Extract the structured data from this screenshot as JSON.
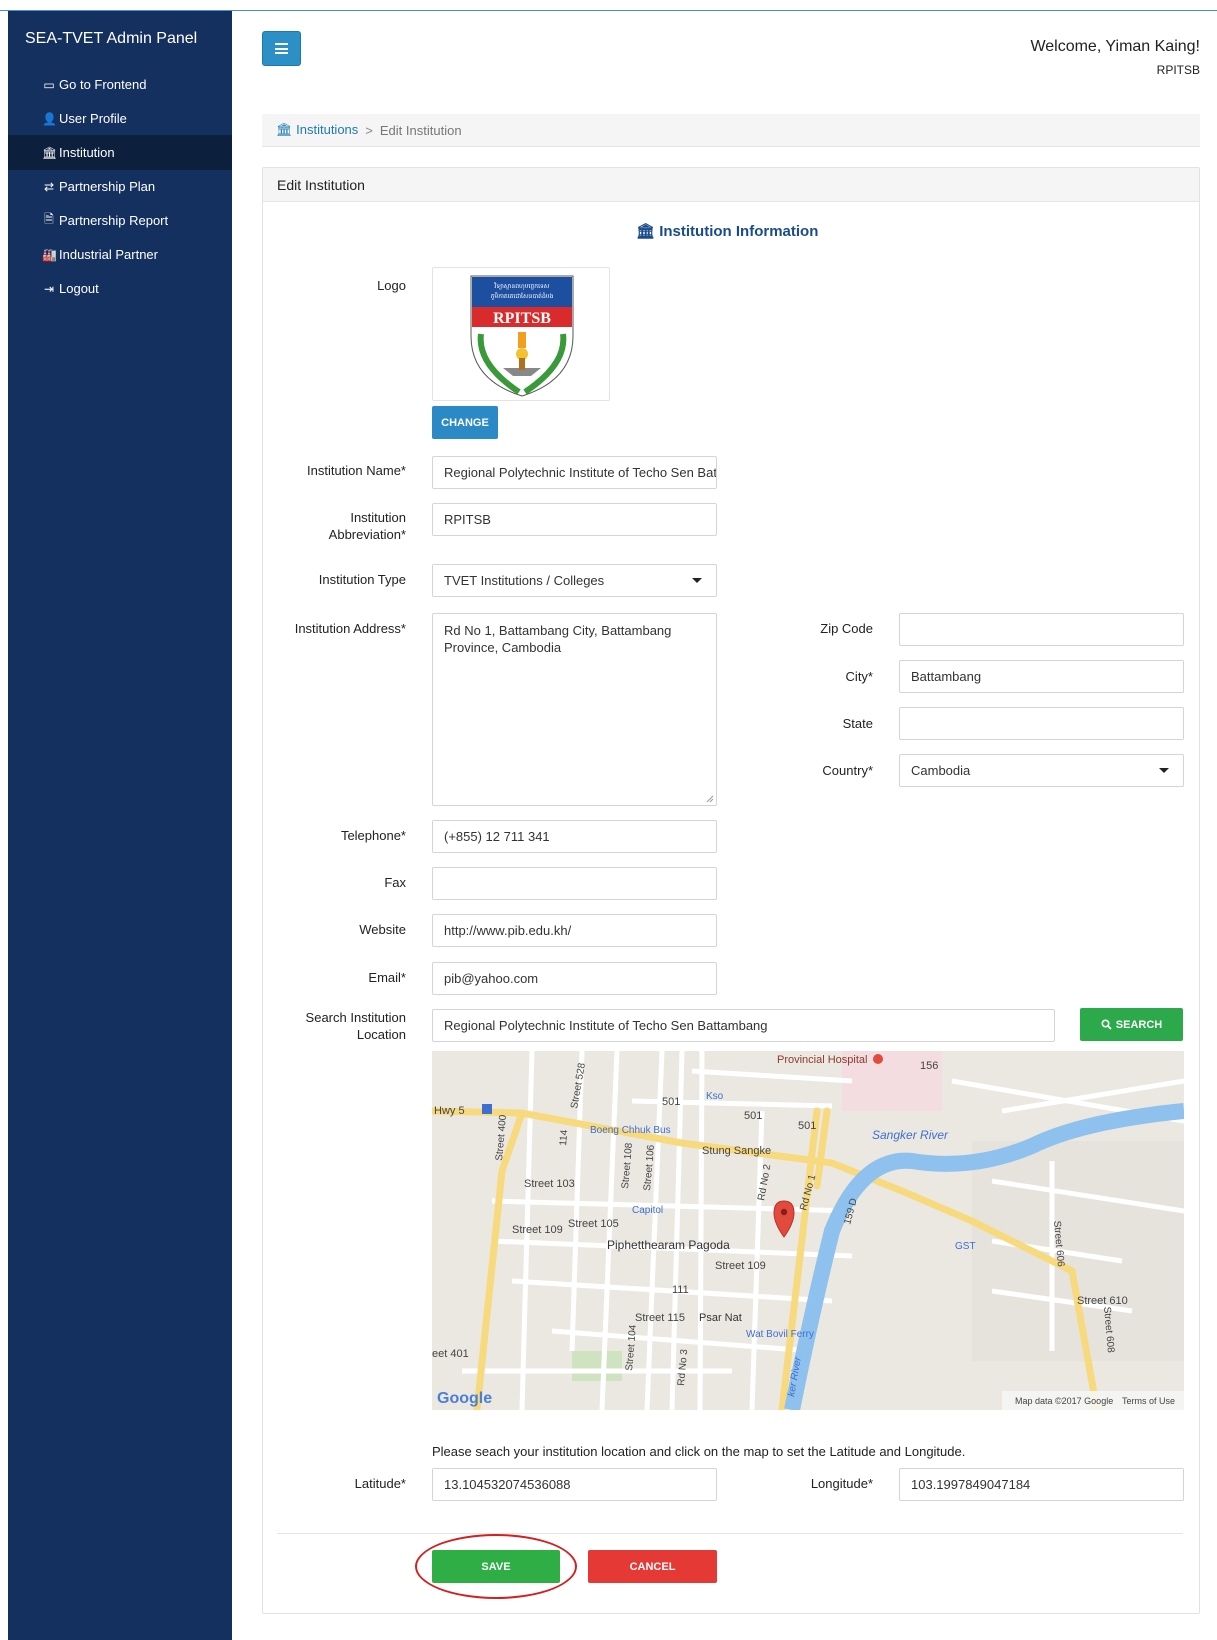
{
  "sidebar": {
    "brand": "SEA-TVET Admin Panel",
    "items": [
      {
        "label": "Go to Frontend",
        "icon": "window-icon",
        "glyph": "▭"
      },
      {
        "label": "User Profile",
        "icon": "user-icon",
        "glyph": "👤"
      },
      {
        "label": "Institution",
        "icon": "institution-icon",
        "glyph": "🏛"
      },
      {
        "label": "Partnership Plan",
        "icon": "exchange-icon",
        "glyph": "⇄"
      },
      {
        "label": "Partnership Report",
        "icon": "report-icon",
        "glyph": "🗎"
      },
      {
        "label": "Industrial Partner",
        "icon": "industry-icon",
        "glyph": "🏭"
      },
      {
        "label": "Logout",
        "icon": "logout-icon",
        "glyph": "⇥"
      }
    ],
    "active_index": 2
  },
  "header": {
    "welcome": "Welcome, Yiman Kaing!",
    "institution": "RPITSB"
  },
  "breadcrumb": {
    "link": "Institutions",
    "separator": ">",
    "current": "Edit Institution"
  },
  "panel": {
    "title": "Edit Institution",
    "section_title": "Institution Information"
  },
  "logo": {
    "label": "Logo",
    "khmer_line1": "វិទ្យាស្ថានពហុបច្ចេកទេស",
    "khmer_line2": "ភូមិភាគតេជោសែនបាត់ដំបង",
    "abbr": "RPITSB",
    "change_button": "CHANGE"
  },
  "form": {
    "name_label": "Institution Name*",
    "name_value": "Regional Polytechnic Institute of Techo Sen Bat",
    "abbr_label_1": "Institution",
    "abbr_label_2": "Abbreviation*",
    "abbr_value": "RPITSB",
    "type_label": "Institution Type",
    "type_value": "TVET Institutions / Colleges",
    "address_label": "Institution Address*",
    "address_line1": "Rd No 1, Battambang City, Battambang",
    "address_line2": "Province, Cambodia",
    "zip_label": "Zip Code",
    "zip_value": "",
    "city_label": "City*",
    "city_value": "Battambang",
    "state_label": "State",
    "state_value": "",
    "country_label": "Country*",
    "country_value": "Cambodia",
    "telephone_label": "Telephone*",
    "telephone_value": "(+855) 12 711 341",
    "fax_label": "Fax",
    "fax_value": "",
    "website_label": "Website",
    "website_value": "http://www.pib.edu.kh/",
    "email_label": "Email*",
    "email_value": "pib@yahoo.com",
    "search_label_1": "Search Institution",
    "search_label_2": "Location",
    "search_value": "Regional Polytechnic Institute of Techo Sen Battambang",
    "search_button": "SEARCH",
    "map_hint": "Please seach your institution location and click on the map to set the Latitude and Longitude.",
    "latitude_label": "Latitude*",
    "latitude_value": "13.104532074536088",
    "longitude_label": "Longitude*",
    "longitude_value": "103.1997849047184",
    "save_button": "SAVE",
    "cancel_button": "CANCEL"
  },
  "map": {
    "labels": {
      "hospital": "Provincial Hospital",
      "hwy5": "Hwy 5",
      "boeng": "Boeng Chhuk Bus",
      "stung": "Stung Sangke",
      "river": "Sangker River",
      "capitol": "Capitol",
      "street103": "Street 103",
      "street105": "Street 105",
      "street109a": "Street 109",
      "street109b": "Street 109",
      "pagoda": "Piphetthearam Pagoda",
      "street115": "Street 115",
      "psar": "Psar Nat",
      "ferry": "Wat Bovil Ferry",
      "gst": "GST",
      "street610": "Street 610",
      "street401": "eet 401",
      "kso": "Kso",
      "n156": "156",
      "n501a": "501",
      "n501b": "501",
      "n501c": "501",
      "n111": "111",
      "street528": "Street 528",
      "street400": "Street 400",
      "n114": "114",
      "street108": "Street 108",
      "street106": "Street 106",
      "rdno2": "Rd No 2",
      "rdno1": "Rd No 1",
      "n159": "159 D",
      "street606": "Street 606",
      "street608": "Street 608",
      "street104": "Street 104",
      "rdno3": "Rd No 3",
      "ker_river": "ker River",
      "google": "Google",
      "map_data": "Map data ©2017 Google",
      "terms": "Terms of Use"
    }
  }
}
